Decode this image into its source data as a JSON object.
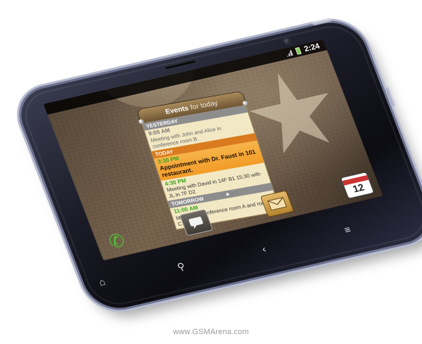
{
  "status_bar": {
    "time": "2:24"
  },
  "widget": {
    "title_main": "Events",
    "title_sub": "for today",
    "sections": {
      "yesterday": {
        "label": "YESTERDAY",
        "time": "9:00 AM",
        "description": "Meeting with John and Alice in conference room B."
      },
      "today": {
        "label": "TODAY",
        "events": [
          {
            "time": "3:30 PM",
            "description": "Appointment with Dr. Faust in 101 restaurant."
          },
          {
            "time": "4:30 PM",
            "description": "Meeting with David in 14F B1 15:30 with JL in 7F D2"
          }
        ]
      },
      "tomorrow": {
        "label": "TOMORROW",
        "time": "11:00 AM",
        "description": "Meeting in conference room A and room C."
      }
    }
  },
  "dock": {
    "calendar_day": "12",
    "icons": [
      "phone-icon",
      "messaging-icon",
      "mail-icon",
      "calendar-icon"
    ]
  },
  "hardware_keys": [
    "home-icon",
    "search-icon",
    "back-icon",
    "menu-icon"
  ],
  "watermark": "www.GSMArena.com",
  "colors": {
    "today_accent": "#d97b1e",
    "event_time_green": "#3aa51c",
    "widget_paper": "#f3e8c4",
    "phone_bezel": "#b7bccf"
  }
}
